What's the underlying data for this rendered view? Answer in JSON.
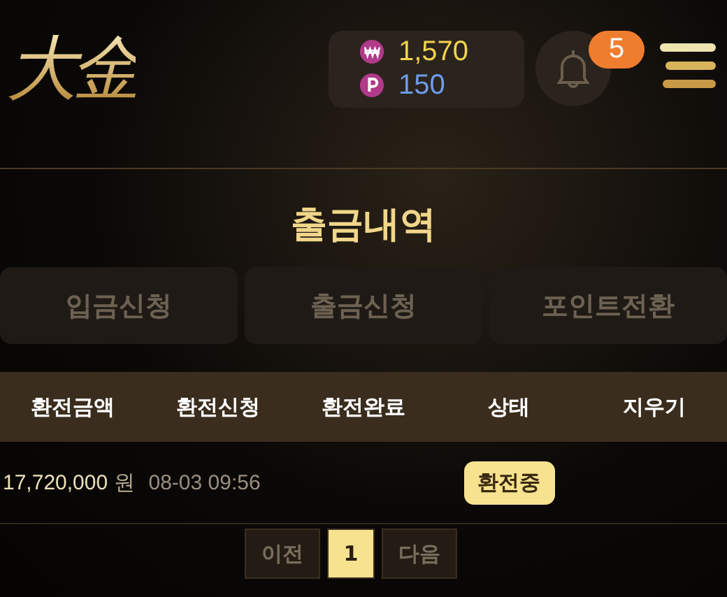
{
  "header": {
    "logo": "大金",
    "balances": [
      {
        "kind": "won",
        "value": "1,570"
      },
      {
        "kind": "point",
        "value": "150"
      }
    ],
    "notifications": "5"
  },
  "title": "출금내역",
  "tabs": [
    {
      "label": "입금신청",
      "selected": false
    },
    {
      "label": "출금신청",
      "selected": false
    },
    {
      "label": "포인트전환",
      "selected": false
    }
  ],
  "table": {
    "columns": [
      "환전금액",
      "환전신청",
      "환전완료",
      "상태",
      "지우기"
    ],
    "rows": [
      {
        "amount": "17,720,000",
        "unit": "원",
        "requested": "08-03 09:56",
        "status": "환전중"
      }
    ]
  },
  "pagination": [
    {
      "label": "이전",
      "selected": false
    },
    {
      "label": "1",
      "selected": true
    },
    {
      "label": "다음",
      "selected": false
    }
  ]
}
